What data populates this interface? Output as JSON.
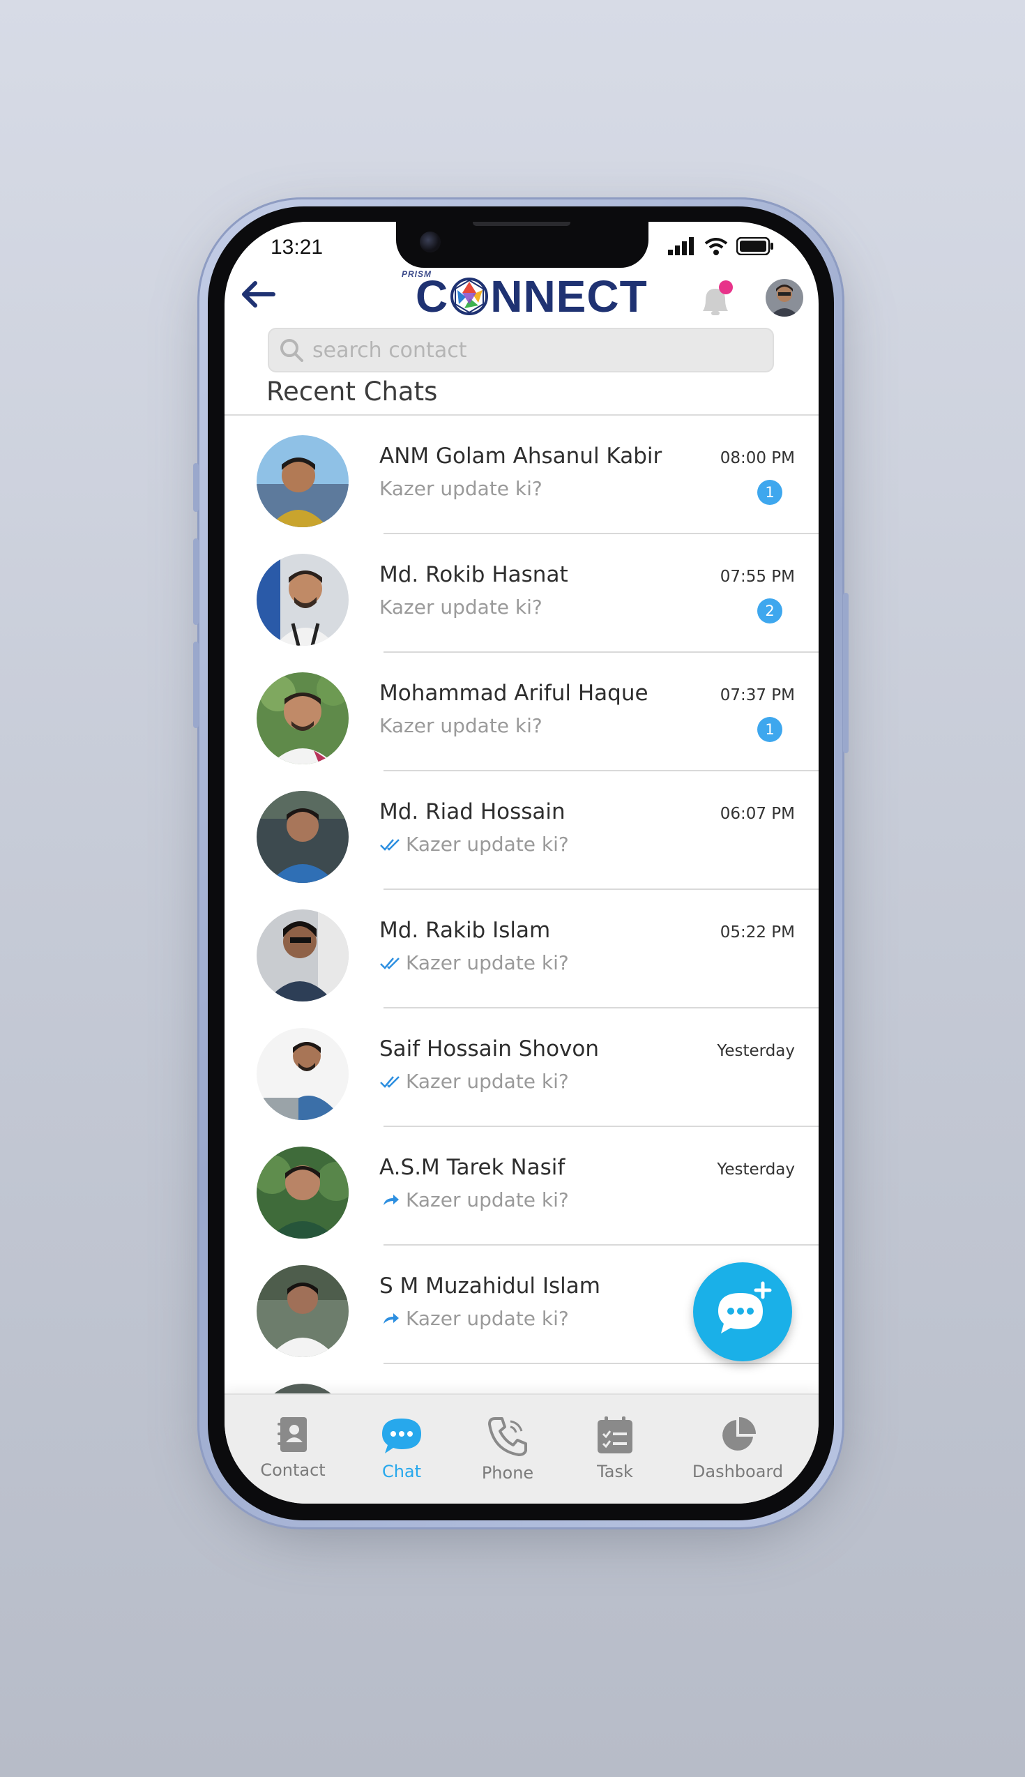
{
  "status_bar": {
    "time": "13:21"
  },
  "header": {
    "logo_prefix": "PRISM",
    "logo_first": "C",
    "logo_rest": "NNECT",
    "notification_dot_color": "#e8338a"
  },
  "search": {
    "placeholder": "search contact",
    "value": ""
  },
  "section_title": "Recent Chats",
  "chats": [
    {
      "name": "ANM Golam Ahsanul Kabir",
      "time": "08:00 PM",
      "preview": "Kazer update ki?",
      "unread": "1",
      "status": "unread"
    },
    {
      "name": "Md. Rokib Hasnat",
      "time": "07:55 PM",
      "preview": "Kazer update ki?",
      "unread": "2",
      "status": "unread"
    },
    {
      "name": "Mohammad Ariful Haque",
      "time": "07:37 PM",
      "preview": "Kazer update ki?",
      "unread": "1",
      "status": "unread"
    },
    {
      "name": "Md. Riad Hossain",
      "time": "06:07 PM",
      "preview": "Kazer update ki?",
      "unread": "",
      "status": "read"
    },
    {
      "name": "Md. Rakib Islam",
      "time": "05:22 PM",
      "preview": "Kazer update ki?",
      "unread": "",
      "status": "read"
    },
    {
      "name": "Saif Hossain Shovon",
      "time": "Yesterday",
      "preview": "Kazer update ki?",
      "unread": "",
      "status": "read"
    },
    {
      "name": "A.S.M Tarek Nasif",
      "time": "Yesterday",
      "preview": "Kazer update ki?",
      "unread": "",
      "status": "forwarded"
    },
    {
      "name": "S M Muzahidul Islam",
      "time": "",
      "preview": "Kazer update ki?",
      "unread": "",
      "status": "forwarded"
    }
  ],
  "fab": {
    "icon": "new-chat-icon"
  },
  "tabs": [
    {
      "label": "Contact",
      "icon": "contact-book-icon",
      "active": false
    },
    {
      "label": "Chat",
      "icon": "chat-bubble-icon",
      "active": true
    },
    {
      "label": "Phone",
      "icon": "phone-icon",
      "active": false
    },
    {
      "label": "Task",
      "icon": "task-list-icon",
      "active": false
    },
    {
      "label": "Dashboard",
      "icon": "pie-chart-icon",
      "active": false
    }
  ],
  "colors": {
    "accent": "#27a8ec",
    "badge": "#3ea7ee",
    "fab": "#1ab0e8",
    "logo": "#1f3272"
  }
}
